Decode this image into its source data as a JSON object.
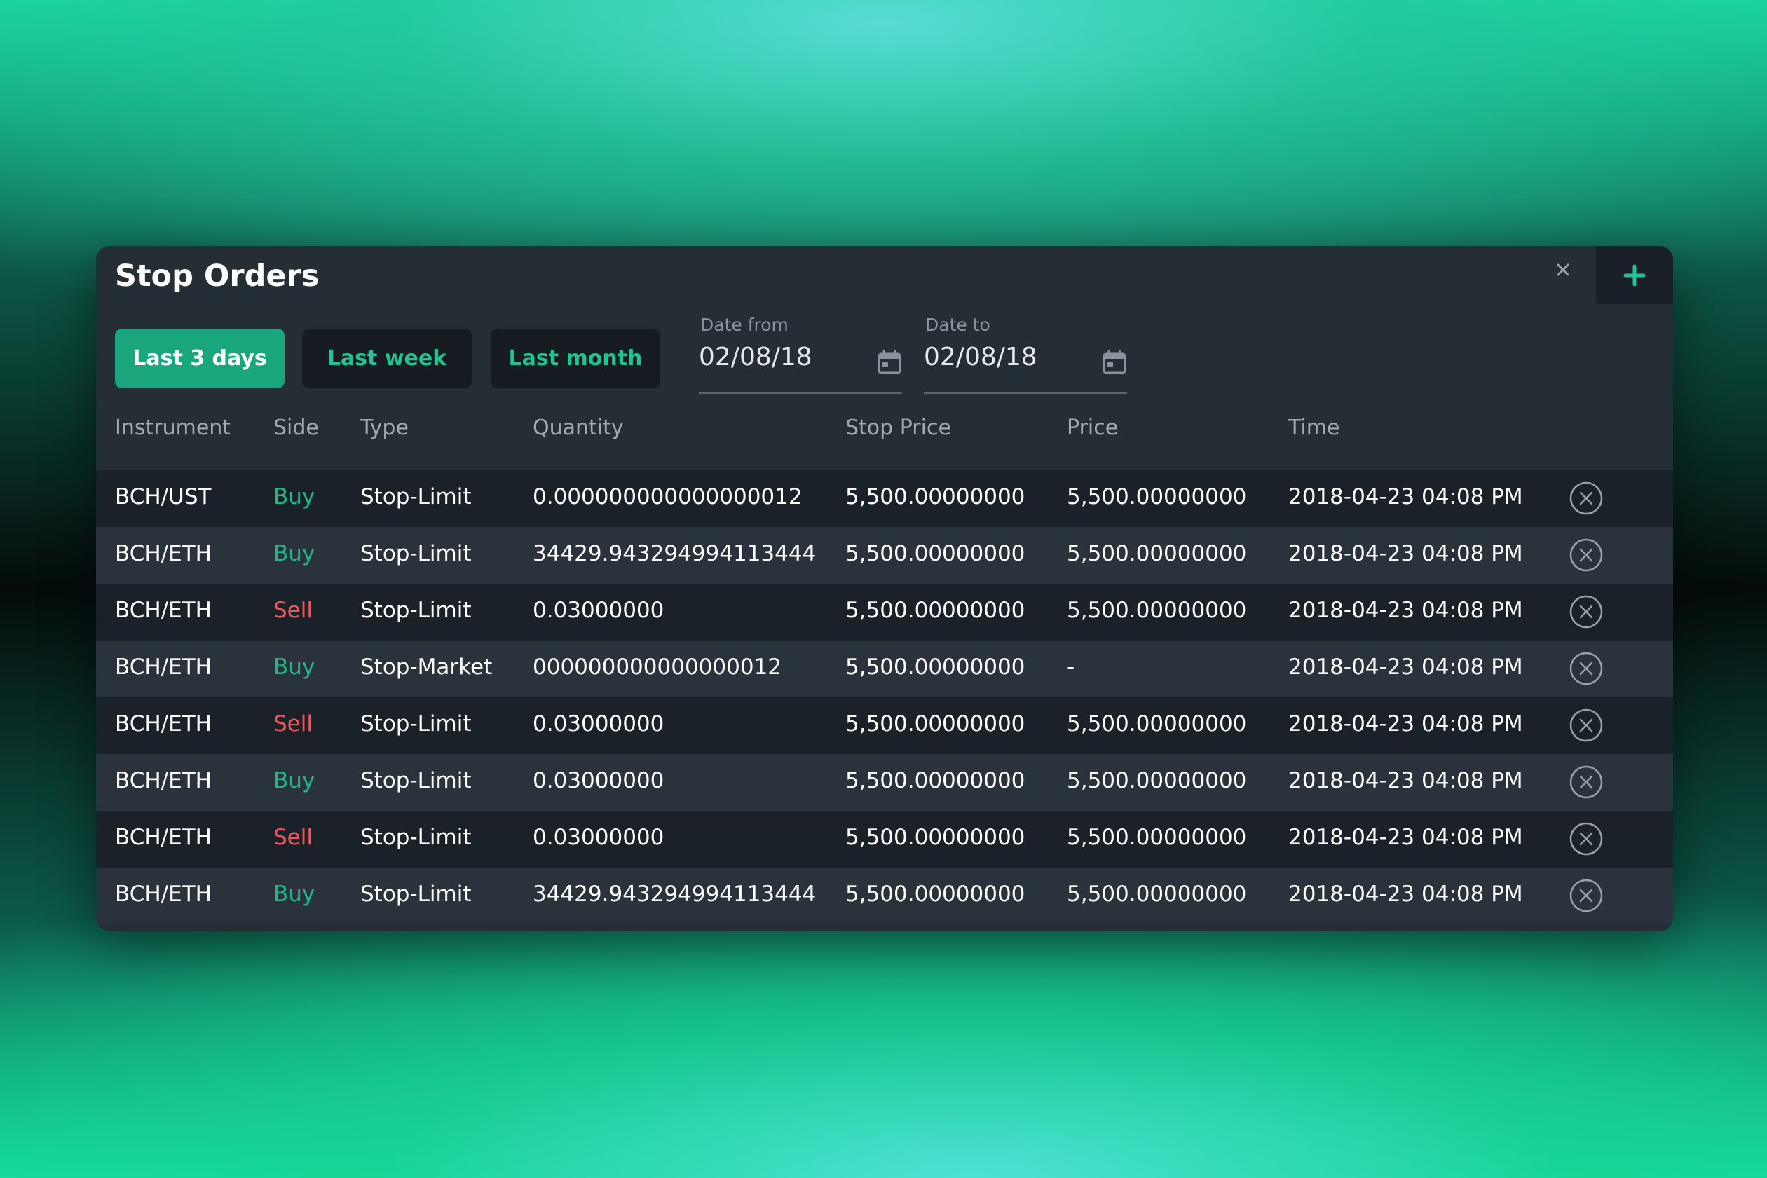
{
  "window": {
    "title": "Stop Orders",
    "close_icon": "close-icon",
    "add_icon": "plus-icon"
  },
  "filters": {
    "buttons": [
      {
        "label": "Last 3 days",
        "active": true
      },
      {
        "label": "Last week",
        "active": false
      },
      {
        "label": "Last month",
        "active": false
      }
    ],
    "date_from": {
      "label": "Date from",
      "value": "02/08/18",
      "icon": "calendar-icon"
    },
    "date_to": {
      "label": "Date to",
      "value": "02/08/18",
      "icon": "calendar-icon"
    }
  },
  "table": {
    "columns": [
      "Instrument",
      "Side",
      "Type",
      "Quantity",
      "Stop Price",
      "Price",
      "Time"
    ],
    "rows": [
      {
        "instrument": "BCH/UST",
        "side": "Buy",
        "type": "Stop-Limit",
        "quantity": "0.000000000000000012",
        "stop_price": "5,500.00000000",
        "price": "5,500.00000000",
        "time": "2018-04-23 04:08 PM"
      },
      {
        "instrument": "BCH/ETH",
        "side": "Buy",
        "type": "Stop-Limit",
        "quantity": "34429.943294994113444",
        "stop_price": "5,500.00000000",
        "price": "5,500.00000000",
        "time": "2018-04-23 04:08 PM"
      },
      {
        "instrument": "BCH/ETH",
        "side": "Sell",
        "type": "Stop-Limit",
        "quantity": "0.03000000",
        "stop_price": "5,500.00000000",
        "price": "5,500.00000000",
        "time": "2018-04-23 04:08 PM"
      },
      {
        "instrument": "BCH/ETH",
        "side": "Buy",
        "type": "Stop-Market",
        "quantity": "000000000000000012",
        "stop_price": "5,500.00000000",
        "price": "-",
        "time": "2018-04-23 04:08 PM"
      },
      {
        "instrument": "BCH/ETH",
        "side": "Sell",
        "type": "Stop-Limit",
        "quantity": "0.03000000",
        "stop_price": "5,500.00000000",
        "price": "5,500.00000000",
        "time": "2018-04-23 04:08 PM"
      },
      {
        "instrument": "BCH/ETH",
        "side": "Buy",
        "type": "Stop-Limit",
        "quantity": "0.03000000",
        "stop_price": "5,500.00000000",
        "price": "5,500.00000000",
        "time": "2018-04-23 04:08 PM"
      },
      {
        "instrument": "BCH/ETH",
        "side": "Sell",
        "type": "Stop-Limit",
        "quantity": "0.03000000",
        "stop_price": "5,500.00000000",
        "price": "5,500.00000000",
        "time": "2018-04-23 04:08 PM"
      },
      {
        "instrument": "BCH/ETH",
        "side": "Buy",
        "type": "Stop-Limit",
        "quantity": "34429.943294994113444",
        "stop_price": "5,500.00000000",
        "price": "5,500.00000000",
        "time": "2018-04-23 04:08 PM"
      }
    ],
    "cancel_icon": "cancel-circle-icon"
  },
  "colors": {
    "accent": "#19a67c",
    "buy": "#1eb985",
    "sell": "#f0565b",
    "panel": "#252d35"
  }
}
